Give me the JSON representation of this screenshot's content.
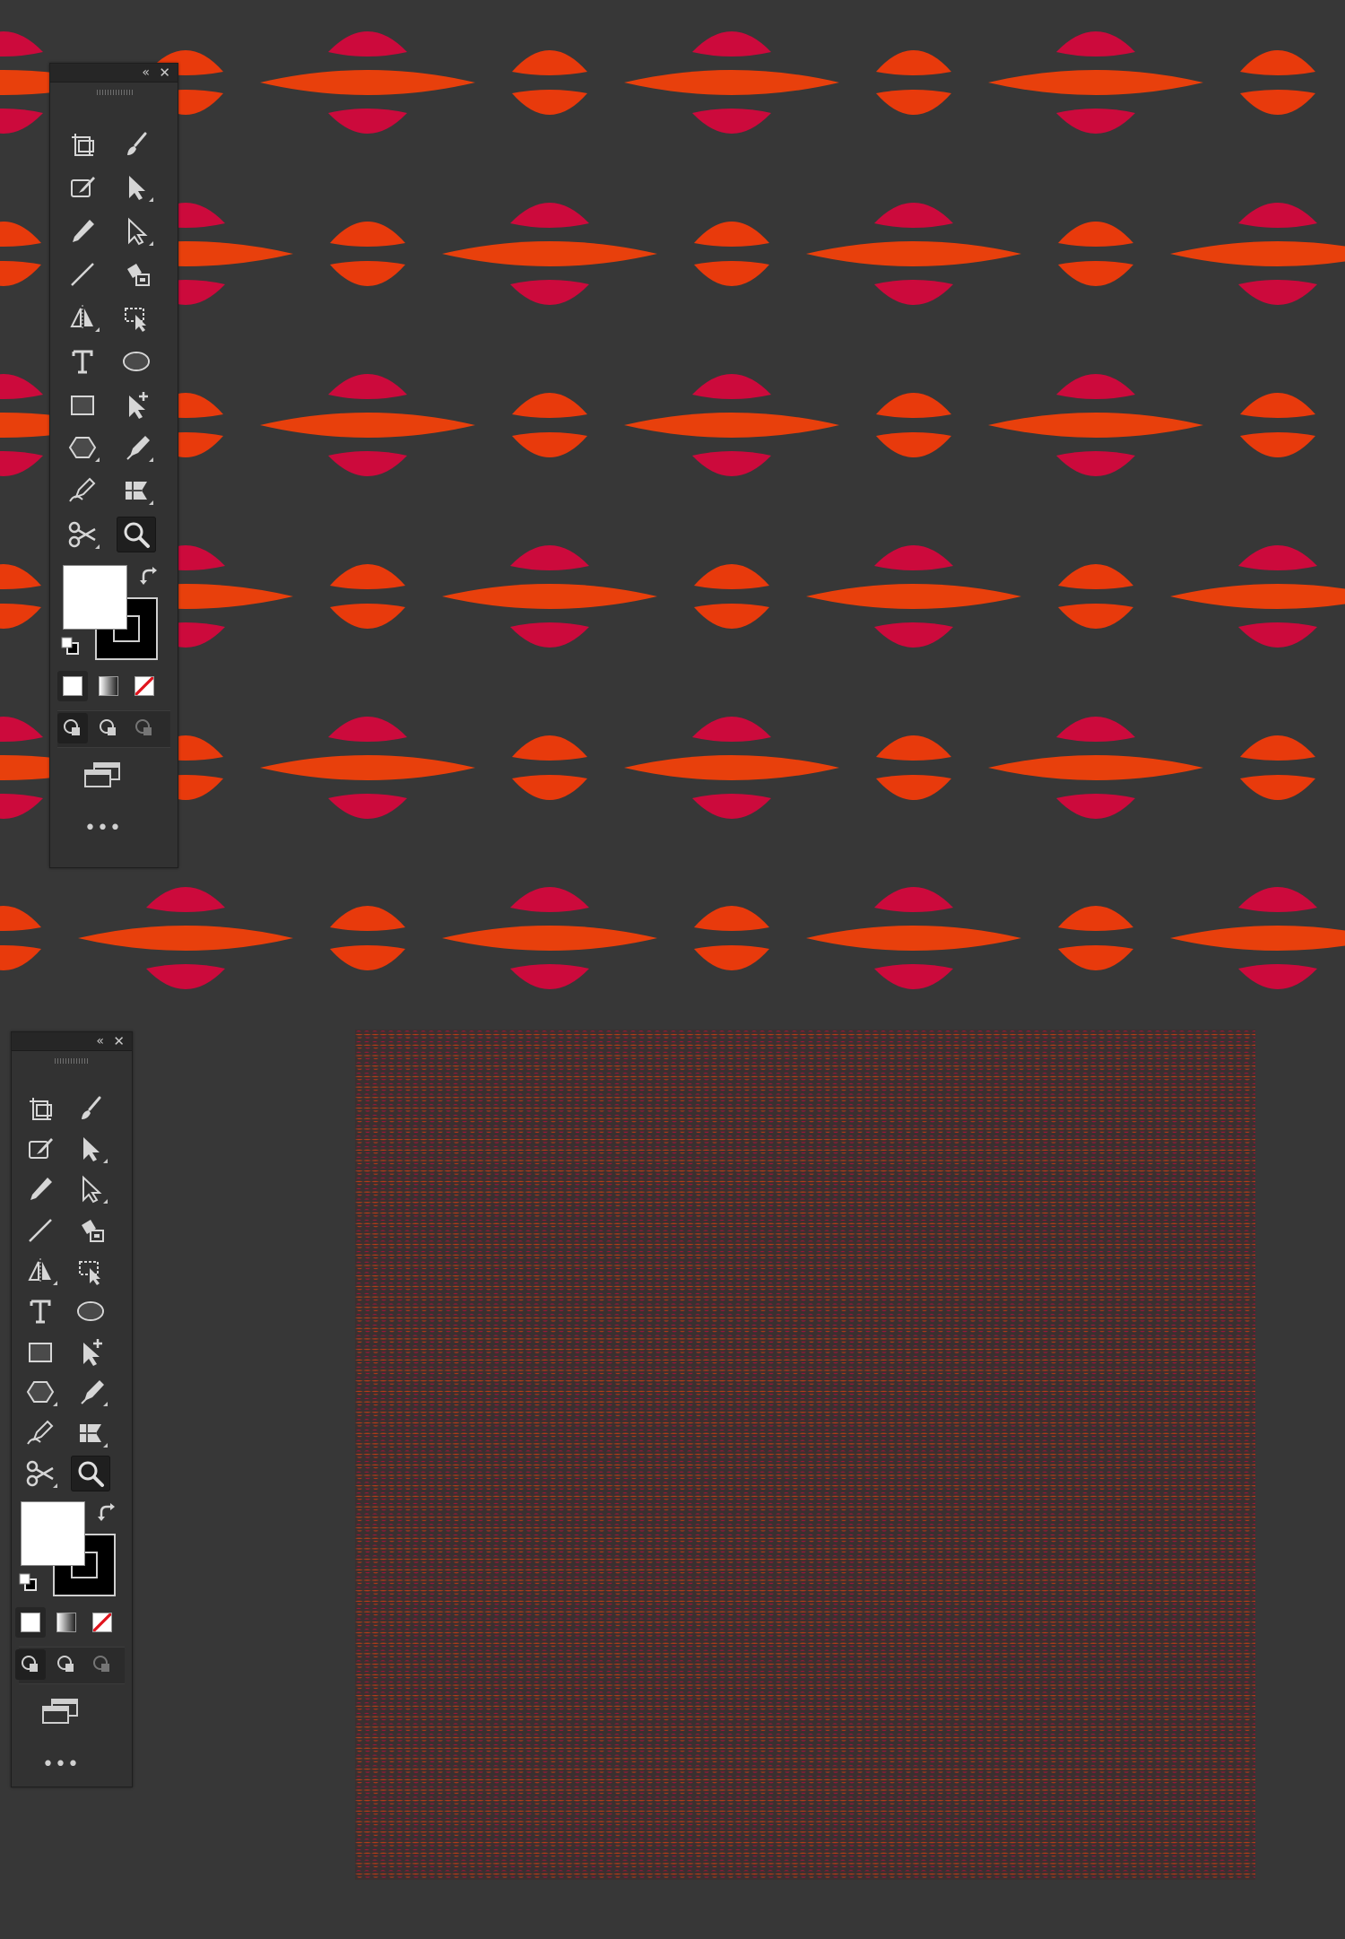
{
  "canvas": {
    "background": "#373737",
    "colors": {
      "petal_top": "#cc0a3c",
      "petal_mid": "#e83a0c",
      "lens": "#e8400c"
    }
  },
  "toolbars": [
    {
      "id": "tools-panel-1"
    },
    {
      "id": "tools-panel-2"
    }
  ],
  "tools": [
    {
      "name": "artboard-icon",
      "flyout": false
    },
    {
      "name": "paintbrush-icon",
      "flyout": false
    },
    {
      "name": "blob-brush-icon",
      "flyout": false
    },
    {
      "name": "selection-arrow-icon",
      "flyout": true
    },
    {
      "name": "pencil-icon",
      "flyout": false
    },
    {
      "name": "direct-selection-icon",
      "flyout": true
    },
    {
      "name": "line-segment-icon",
      "flyout": false
    },
    {
      "name": "live-paint-bucket-icon",
      "flyout": false
    },
    {
      "name": "reflect-icon",
      "flyout": true
    },
    {
      "name": "free-transform-icon",
      "flyout": false
    },
    {
      "name": "type-icon",
      "flyout": false
    },
    {
      "name": "ellipse-icon",
      "flyout": false
    },
    {
      "name": "rectangle-icon",
      "flyout": false
    },
    {
      "name": "add-anchor-point-icon",
      "flyout": false
    },
    {
      "name": "polygon-icon",
      "flyout": true
    },
    {
      "name": "pen-icon",
      "flyout": true
    },
    {
      "name": "curvature-pen-icon",
      "flyout": false
    },
    {
      "name": "gradient-mesh-icon",
      "flyout": true
    },
    {
      "name": "scissors-icon",
      "flyout": true
    },
    {
      "name": "zoom-icon",
      "flyout": false,
      "active": true
    }
  ],
  "swatches": {
    "fill": "#ffffff",
    "stroke": "#000000"
  },
  "color_modes": [
    "solid-color-icon",
    "gradient-icon",
    "none-color-icon"
  ],
  "draw_modes": [
    "draw-normal-icon",
    "draw-behind-icon",
    "draw-inside-icon"
  ],
  "screen_mode_icon": "screen-mode-icon",
  "more_tools_label": "•••",
  "collapse_label": "«",
  "close_label": "✕"
}
